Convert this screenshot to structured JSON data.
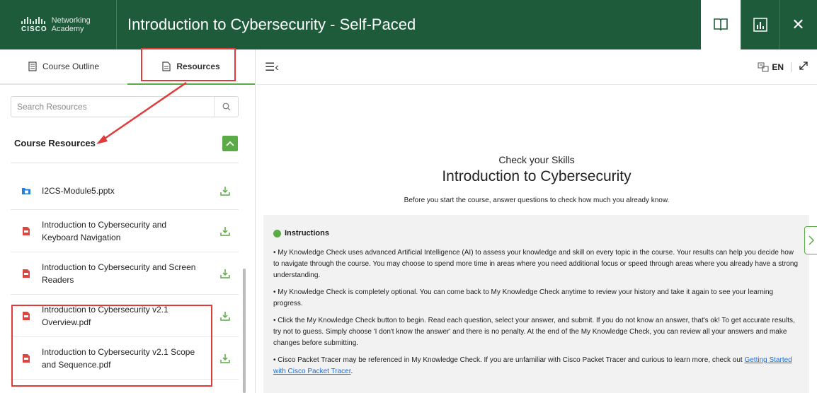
{
  "header": {
    "logo_word": "CISCO",
    "logo_line1": "Networking",
    "logo_line2": "Academy",
    "course_title": "Introduction to Cybersecurity - Self-Paced",
    "close_glyph": "✕"
  },
  "left": {
    "tabs": [
      {
        "label": "Course Outline",
        "icon": "list-icon",
        "active": false
      },
      {
        "label": "Resources",
        "icon": "document-icon",
        "active": true
      }
    ],
    "search": {
      "placeholder": "Search Resources"
    },
    "section_title": "Course Resources",
    "resources": [
      {
        "name": "I2CS-Module5.pptx",
        "type": "pptx",
        "icon": "folder-file-icon"
      },
      {
        "name": "Introduction to Cybersecurity and Keyboard Navigation",
        "type": "pdf",
        "icon": "pdf-icon"
      },
      {
        "name": "Introduction to Cybersecurity and Screen Readers",
        "type": "pdf",
        "icon": "pdf-icon"
      },
      {
        "name": "Introduction to Cybersecurity v2.1 Overview.pdf",
        "type": "pdf",
        "icon": "pdf-icon"
      },
      {
        "name": "Introduction to Cybersecurity v2.1 Scope and Sequence.pdf",
        "type": "pdf",
        "icon": "pdf-icon"
      }
    ]
  },
  "right": {
    "menu_glyph": "☰‹",
    "language": "EN",
    "check": {
      "subtitle": "Check your Skills",
      "title": "Introduction to Cybersecurity",
      "description": "Before you start the course, answer questions to check how much you already know."
    },
    "instructions": {
      "heading": "Instructions",
      "bullets": [
        "• My Knowledge Check uses advanced Artificial Intelligence (AI) to assess your knowledge and skill on every topic in the course. Your results can help you decide how to navigate through the course. You may choose to spend more time in areas where you need additional focus or speed through areas where you already have a strong understanding.",
        "• My Knowledge Check is completely optional. You can come back to My Knowledge Check anytime to review your history and take it again to see your learning progress.",
        "• Click the My Knowledge Check button to begin. Read each question, select your answer, and submit. If you do not know an answer, that's ok! To get accurate results, try not to guess. Simply choose 'I don't know the answer' and there is no penalty. At the end of the My Knowledge Check, you can review all your answers and make changes before submitting."
      ],
      "last_bullet_prefix": "• Cisco Packet Tracer may be referenced in My Knowledge Check. If you are unfamiliar with Cisco Packet Tracer and curious to learn more, check out ",
      "last_bullet_link": "Getting Started with Cisco Packet Tracer",
      "last_bullet_suffix": "."
    }
  },
  "colors": {
    "header_bg": "#1d5b3a",
    "accent_green": "#5aab46",
    "annotation_red": "#e03a3a",
    "link_blue": "#1a6ed8"
  }
}
